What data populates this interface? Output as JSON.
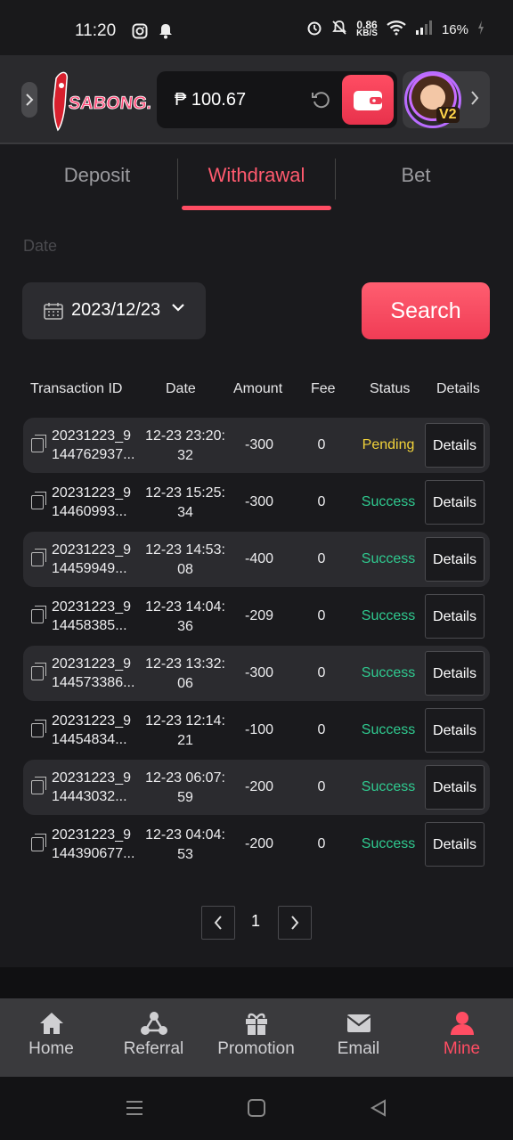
{
  "status_bar": {
    "time": "11:20",
    "net_speed_value": "0.86",
    "net_speed_unit": "KB/S",
    "battery": "16%"
  },
  "header": {
    "logo_text": "SABONG.BET",
    "balance": "₱ 100.67",
    "vip_level": "V2"
  },
  "tabs": [
    {
      "label": "Deposit",
      "active": false
    },
    {
      "label": "Withdrawal",
      "active": true
    },
    {
      "label": "Bet",
      "active": false
    }
  ],
  "filter": {
    "date_label": "Date",
    "date_value": "2023/12/23",
    "search_label": "Search"
  },
  "table": {
    "columns": [
      "Transaction ID",
      "Date",
      "Amount",
      "Fee",
      "Status",
      "Details"
    ],
    "rows": [
      {
        "id1": "20231223_9",
        "id2": "144762937...",
        "d1": "12-23 23:20:",
        "d2": "32",
        "amount": "-300",
        "fee": "0",
        "status": "Pending",
        "details": "Details"
      },
      {
        "id1": "20231223_9",
        "id2": "14460993...",
        "d1": "12-23 15:25:",
        "d2": "34",
        "amount": "-300",
        "fee": "0",
        "status": "Success",
        "details": "Details"
      },
      {
        "id1": "20231223_9",
        "id2": "14459949...",
        "d1": "12-23 14:53:",
        "d2": "08",
        "amount": "-400",
        "fee": "0",
        "status": "Success",
        "details": "Details"
      },
      {
        "id1": "20231223_9",
        "id2": "14458385...",
        "d1": "12-23 14:04:",
        "d2": "36",
        "amount": "-209",
        "fee": "0",
        "status": "Success",
        "details": "Details"
      },
      {
        "id1": "20231223_9",
        "id2": "144573386...",
        "d1": "12-23 13:32:",
        "d2": "06",
        "amount": "-300",
        "fee": "0",
        "status": "Success",
        "details": "Details"
      },
      {
        "id1": "20231223_9",
        "id2": "14454834...",
        "d1": "12-23 12:14:",
        "d2": "21",
        "amount": "-100",
        "fee": "0",
        "status": "Success",
        "details": "Details"
      },
      {
        "id1": "20231223_9",
        "id2": "14443032...",
        "d1": "12-23 06:07:",
        "d2": "59",
        "amount": "-200",
        "fee": "0",
        "status": "Success",
        "details": "Details"
      },
      {
        "id1": "20231223_9",
        "id2": "144390677...",
        "d1": "12-23 04:04:",
        "d2": "53",
        "amount": "-200",
        "fee": "0",
        "status": "Success",
        "details": "Details"
      }
    ]
  },
  "pagination": {
    "current_page": "1"
  },
  "bottom_nav": [
    {
      "label": "Home",
      "icon": "home-icon",
      "active": false
    },
    {
      "label": "Referral",
      "icon": "referral-icon",
      "active": false
    },
    {
      "label": "Promotion",
      "icon": "gift-icon",
      "active": false
    },
    {
      "label": "Email",
      "icon": "email-icon",
      "active": false
    },
    {
      "label": "Mine",
      "icon": "user-icon",
      "active": true
    }
  ],
  "colors": {
    "accent": "#ff4d63",
    "pending": "#f2d33a",
    "success": "#2fc98f",
    "background": "#1a1a1d"
  }
}
